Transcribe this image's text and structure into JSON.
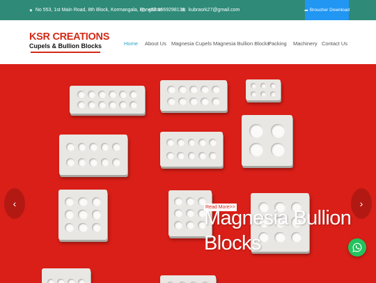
{
  "topbar": {
    "address": "No 553, 1st Main Road, 8th Block, Kormangala, Bangalore",
    "phone": "+97 1569298136",
    "email": "kubrasrk27@gmail.com",
    "download_label": "Broucher Download"
  },
  "logo": {
    "line1": "KSR CREATIONS",
    "line2": "Cupels & Bullion Blocks"
  },
  "nav": {
    "items": [
      "Home",
      "About Us",
      "Magnesia Cupels",
      "Magnesia Bullion Blocks",
      "Packing",
      "Machinery",
      "Contact Us"
    ],
    "active": "Home"
  },
  "hero": {
    "title_line1": "Magnesia Bullion",
    "title_line2": "Blocks",
    "read_more": "Read More>>",
    "prev_glyph": "‹",
    "next_glyph": "›"
  },
  "colors": {
    "topbar": "#2f8a78",
    "download": "#2196f3",
    "brand_red": "#d32a17",
    "hero_bg": "#d91f17",
    "nav_active": "#29a3c9",
    "whatsapp": "#22c35e"
  },
  "icons": [
    "location-icon",
    "phone-icon",
    "email-icon",
    "share-icon",
    "chevron-left-icon",
    "chevron-right-icon",
    "whatsapp-icon"
  ]
}
